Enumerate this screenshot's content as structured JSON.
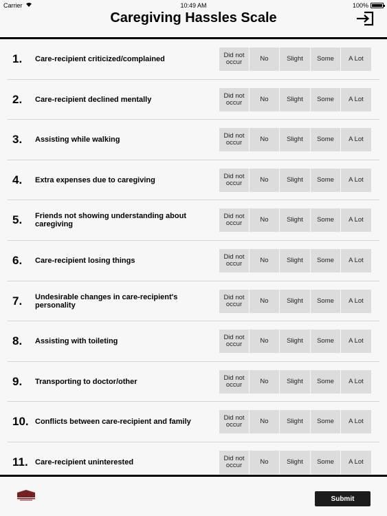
{
  "status": {
    "carrier": "Carrier",
    "time": "10:49 AM",
    "battery": "100%"
  },
  "nav": {
    "title": "Caregiving Hassles Scale",
    "exit_icon": "exit-icon"
  },
  "options": [
    "Did not occur",
    "No",
    "Slight",
    "Some",
    "A Lot"
  ],
  "items": [
    {
      "num": "1.",
      "label": "Care-recipient criticized/complained"
    },
    {
      "num": "2.",
      "label": "Care-recipient declined mentally"
    },
    {
      "num": "3.",
      "label": "Assisting while walking"
    },
    {
      "num": "4.",
      "label": "Extra expenses due to caregiving"
    },
    {
      "num": "5.",
      "label": "Friends not showing understanding about caregiving"
    },
    {
      "num": "6.",
      "label": "Care-recipient losing things"
    },
    {
      "num": "7.",
      "label": "Undesirable changes in care-recipient's personality"
    },
    {
      "num": "8.",
      "label": "Assisting with toileting"
    },
    {
      "num": "9.",
      "label": "Transporting to doctor/other"
    },
    {
      "num": "10.",
      "label": "Conflicts between care-recipient and family"
    },
    {
      "num": "11.",
      "label": "Care-recipient uninterested"
    }
  ],
  "footer": {
    "submit_label": "Submit",
    "logo_icon": "university-logo-icon"
  }
}
